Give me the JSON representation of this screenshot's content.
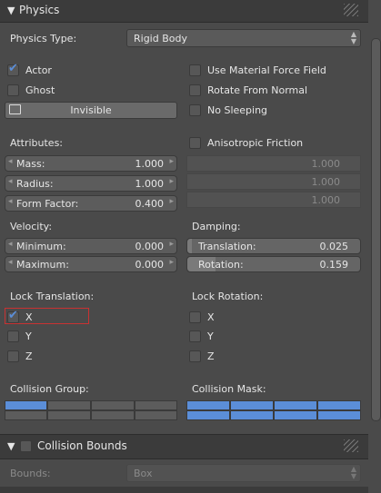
{
  "physics_panel": {
    "title": "Physics",
    "physics_type_label": "Physics Type:",
    "physics_type_value": "Rigid Body",
    "actor_label": "Actor",
    "actor_checked": true,
    "ghost_label": "Ghost",
    "invisible_label": "Invisible",
    "use_material_force_field_label": "Use Material Force Field",
    "rotate_from_normal_label": "Rotate From Normal",
    "no_sleeping_label": "No Sleeping",
    "attributes_label": "Attributes:",
    "mass_label": "Mass:",
    "mass_value": "1.000",
    "radius_label": "Radius:",
    "radius_value": "1.000",
    "form_factor_label": "Form Factor:",
    "form_factor_value": "0.400",
    "anisotropic_friction_label": "Anisotropic Friction",
    "aniso_x": "1.000",
    "aniso_y": "1.000",
    "aniso_z": "1.000",
    "velocity_label": "Velocity:",
    "velocity_min_label": "Minimum:",
    "velocity_min_value": "0.000",
    "velocity_max_label": "Maximum:",
    "velocity_max_value": "0.000",
    "damping_label": "Damping:",
    "damping_translation_label": "Translation:",
    "damping_translation_value": "0.025",
    "damping_rotation_label": "Rotation:",
    "damping_rotation_value": "0.159",
    "lock_translation_label": "Lock Translation:",
    "lock_rotation_label": "Lock Rotation:",
    "axis_x": "X",
    "axis_y": "Y",
    "axis_z": "Z",
    "collision_group_label": "Collision Group:",
    "collision_mask_label": "Collision Mask:"
  },
  "collision_bounds_panel": {
    "title": "Collision Bounds",
    "bounds_label": "Bounds:",
    "bounds_value": "Box"
  },
  "colors": {
    "accent_blue": "#5b8ed8",
    "highlight_red": "#c83232",
    "panel_bg": "#4a4a4a"
  }
}
